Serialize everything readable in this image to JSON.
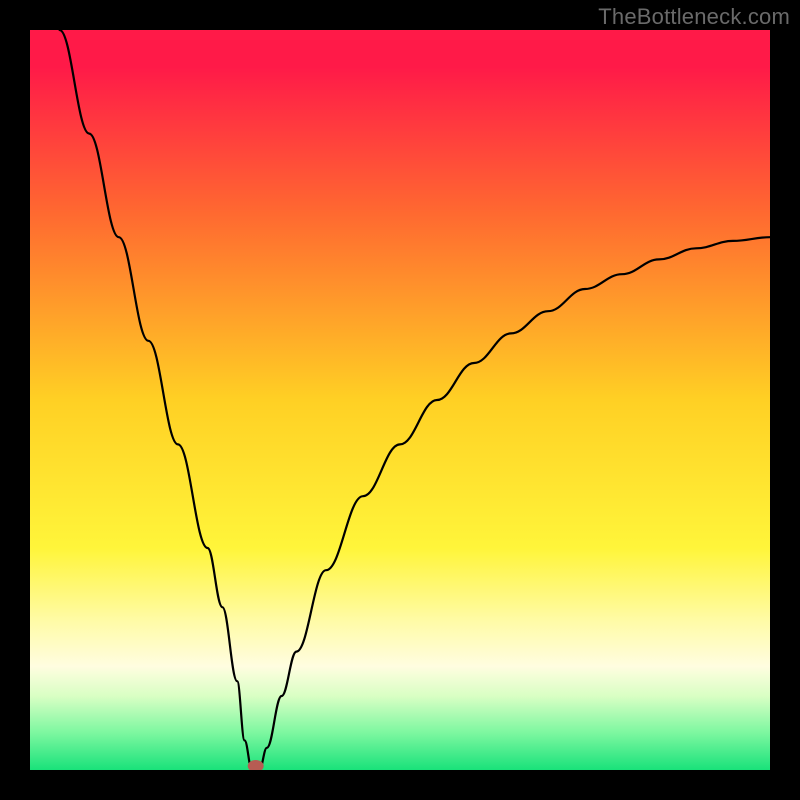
{
  "watermark": "TheBottleneck.com",
  "chart_data": {
    "type": "line",
    "title": "",
    "xlabel": "",
    "ylabel": "",
    "xlim": [
      0,
      100
    ],
    "ylim": [
      0,
      100
    ],
    "grid": false,
    "series": [
      {
        "name": "curve",
        "color": "#000000",
        "x": [
          4,
          8,
          12,
          16,
          20,
          24,
          26,
          28,
          29,
          30,
          31,
          32,
          34,
          36,
          40,
          45,
          50,
          55,
          60,
          65,
          70,
          75,
          80,
          85,
          90,
          95,
          100
        ],
        "y": [
          100,
          86,
          72,
          58,
          44,
          30,
          22,
          12,
          4,
          0,
          0,
          3,
          10,
          16,
          27,
          37,
          44,
          50,
          55,
          59,
          62,
          65,
          67,
          69,
          70.5,
          71.5,
          72
        ]
      }
    ],
    "marker": {
      "x": 30.5,
      "y": 0,
      "color": "#b75c53"
    },
    "background_gradient": {
      "stops": [
        {
          "offset": 0.0,
          "color": "#ff1a48"
        },
        {
          "offset": 0.05,
          "color": "#ff1a48"
        },
        {
          "offset": 0.25,
          "color": "#ff6a30"
        },
        {
          "offset": 0.5,
          "color": "#ffd024"
        },
        {
          "offset": 0.7,
          "color": "#fff53a"
        },
        {
          "offset": 0.8,
          "color": "#fffba8"
        },
        {
          "offset": 0.86,
          "color": "#fffde0"
        },
        {
          "offset": 0.9,
          "color": "#d9ffc4"
        },
        {
          "offset": 0.95,
          "color": "#7cf7a0"
        },
        {
          "offset": 1.0,
          "color": "#19e27a"
        }
      ]
    }
  }
}
